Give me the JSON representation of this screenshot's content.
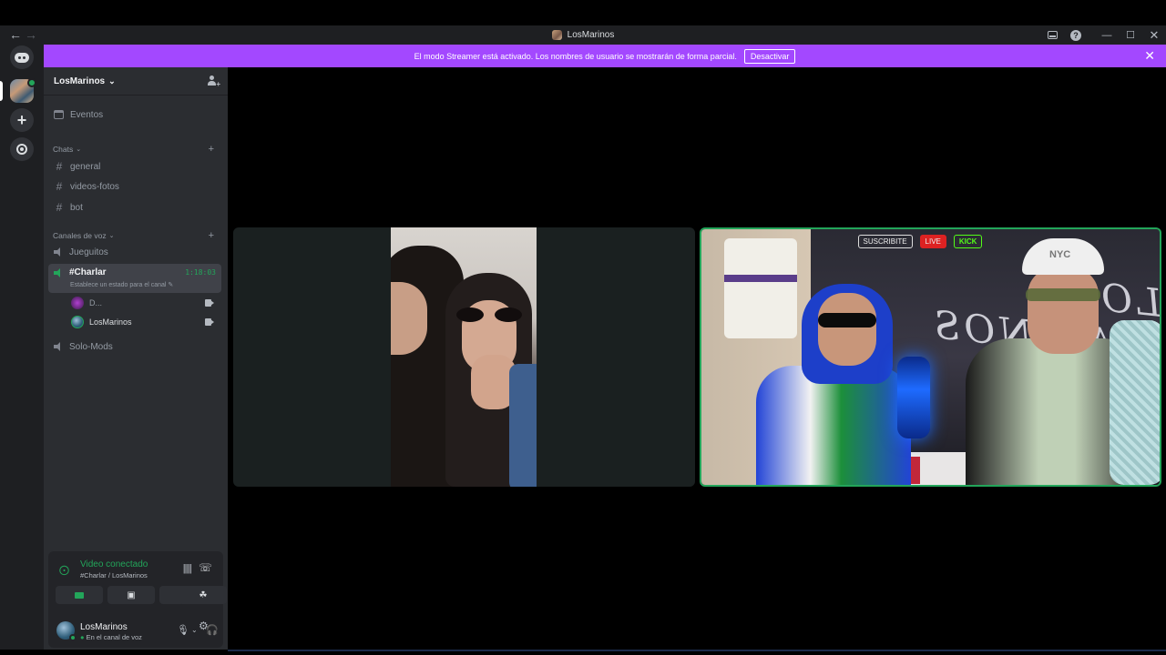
{
  "titlebar": {
    "back_icon": "arrow-left-icon",
    "forward_icon": "arrow-right-icon",
    "title": "LosMarinos"
  },
  "banner": {
    "text": "El modo Streamer está activado. Los nombres de usuario se mostrarán de forma parcial.",
    "button": "Desactivar"
  },
  "server": {
    "name": "LosMarinos"
  },
  "sidebar": {
    "events_label": "Eventos",
    "chats_category": "Chats",
    "text_channels": [
      "general",
      "videos-fotos",
      "bot"
    ],
    "voice_category": "Canales de voz",
    "voice_channels": {
      "jueguitos": "Jueguitos",
      "active": {
        "name": "#Charlar",
        "timer": "1:18:03",
        "status": "Establece un estado para el canal"
      },
      "solo_mods": "Solo-Mods"
    },
    "voice_users": [
      "D...",
      "LosMarinos"
    ]
  },
  "voice_panel": {
    "title": "Video conectado",
    "subtitle": "#Charlar / LosMarinos"
  },
  "user_bar": {
    "name": "LosMarinos",
    "status": "En el canal de voz"
  },
  "stream_overlay": {
    "chips": [
      "SUSCRIBITE",
      "LIVE",
      "KICK"
    ],
    "sign": "LOS MARINOS",
    "cap_text": "NYC"
  },
  "colors": {
    "banner": "#a348ff",
    "connected_green": "#23a55a",
    "sidebar_bg": "#2b2d31",
    "rail_bg": "#1e1f22"
  }
}
